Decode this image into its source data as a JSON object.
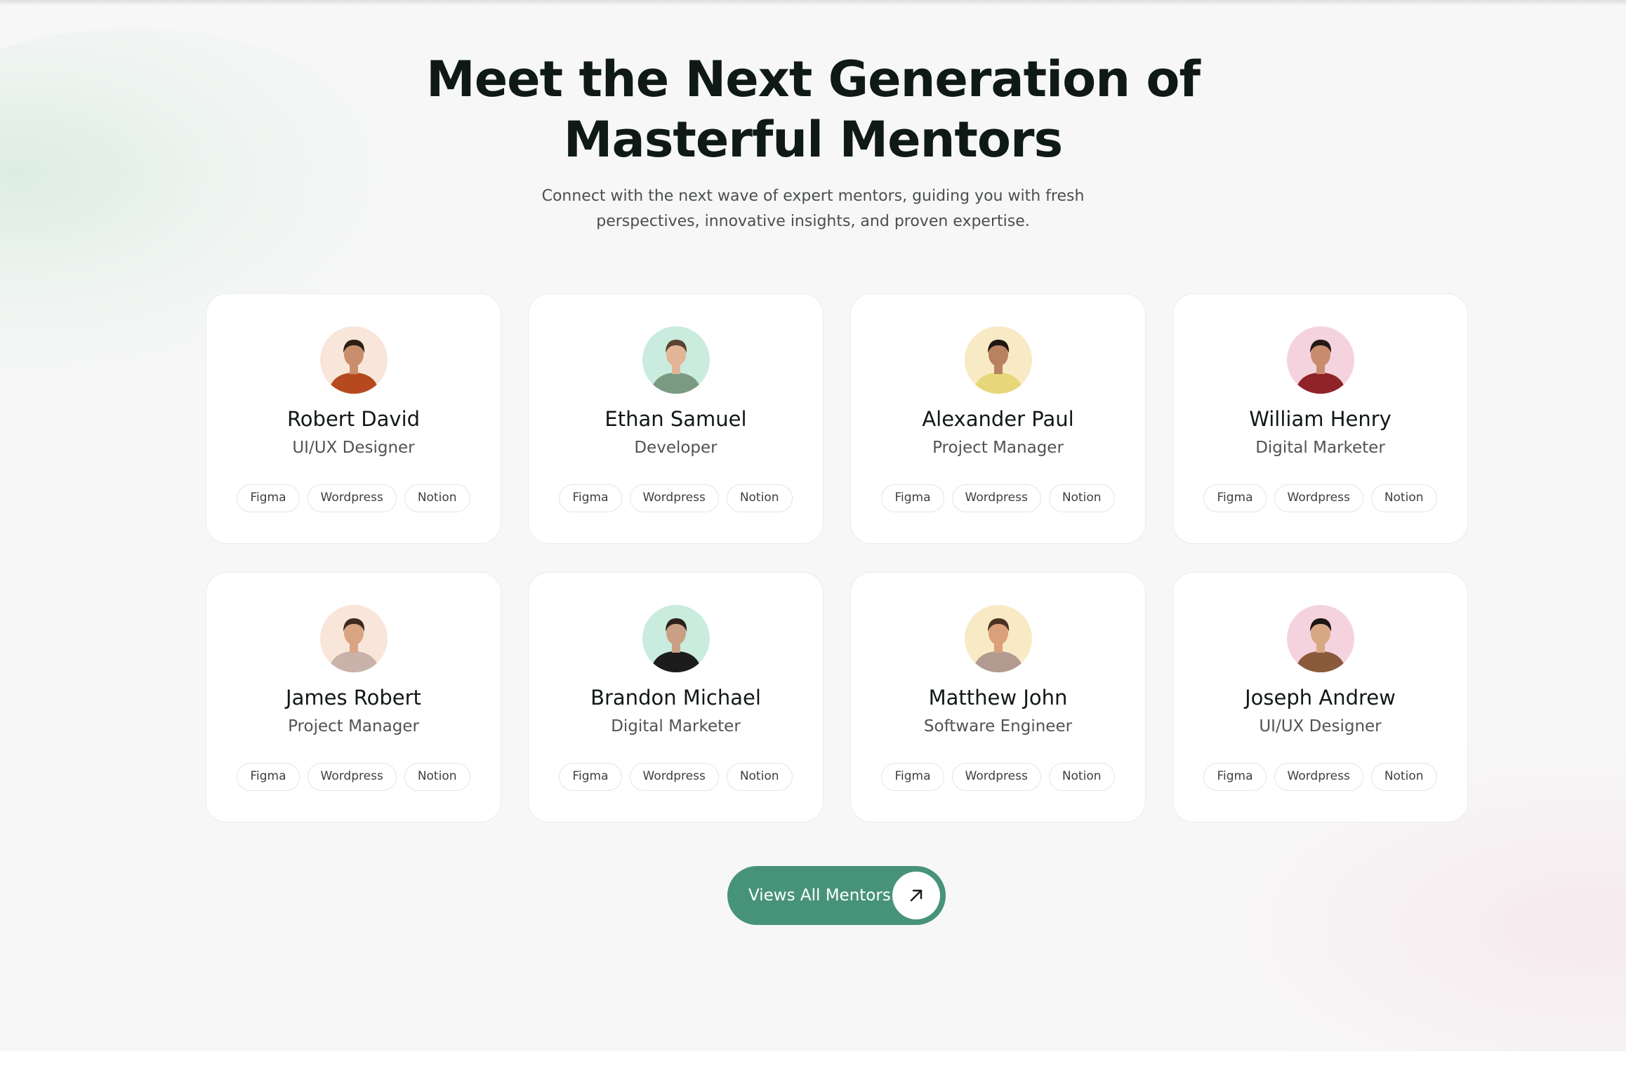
{
  "section": {
    "heading_line1": "Meet the Next Generation of",
    "heading_line2": "Masterful Mentors",
    "subtitle_line1": "Connect with the next wave of expert mentors, guiding you with fresh",
    "subtitle_line2": "perspectives, innovative insights, and proven expertise."
  },
  "mentors": [
    {
      "name": "Robert David",
      "role": "UI/UX Designer",
      "tags": [
        "Figma",
        "Wordpress",
        "Notion"
      ],
      "avatar_bg": "#f8e6da",
      "shirt": "#b64a1e",
      "skin": "#c98f6c",
      "hair": "#2b1f18"
    },
    {
      "name": "Ethan Samuel",
      "role": "Developer",
      "tags": [
        "Figma",
        "Wordpress",
        "Notion"
      ],
      "avatar_bg": "#c9ecdf",
      "shirt": "#7a9a82",
      "skin": "#e2b596",
      "hair": "#5a4332"
    },
    {
      "name": "Alexander Paul",
      "role": "Project Manager",
      "tags": [
        "Figma",
        "Wordpress",
        "Notion"
      ],
      "avatar_bg": "#f7eac5",
      "shirt": "#e8d77a",
      "skin": "#b88160",
      "hair": "#1f1712"
    },
    {
      "name": "William Henry",
      "role": "Digital Marketer",
      "tags": [
        "Figma",
        "Wordpress",
        "Notion"
      ],
      "avatar_bg": "#f5d3de",
      "shirt": "#8f2328",
      "skin": "#c98b6d",
      "hair": "#231a16"
    },
    {
      "name": "James Robert",
      "role": "Project Manager",
      "tags": [
        "Figma",
        "Wordpress",
        "Notion"
      ],
      "avatar_bg": "#f8e6da",
      "shirt": "#c9b2a9",
      "skin": "#d9a482",
      "hair": "#3a2a20"
    },
    {
      "name": "Brandon Michael",
      "role": "Digital Marketer",
      "tags": [
        "Figma",
        "Wordpress",
        "Notion"
      ],
      "avatar_bg": "#c9ecdf",
      "shirt": "#1c1c1c",
      "skin": "#caa084",
      "hair": "#2a211b"
    },
    {
      "name": "Matthew John",
      "role": "Software Engineer",
      "tags": [
        "Figma",
        "Wordpress",
        "Notion"
      ],
      "avatar_bg": "#f7eac5",
      "shirt": "#b39a8e",
      "skin": "#d9a07a",
      "hair": "#4a3222"
    },
    {
      "name": "Joseph Andrew",
      "role": "UI/UX Designer",
      "tags": [
        "Figma",
        "Wordpress",
        "Notion"
      ],
      "avatar_bg": "#f5d3de",
      "shirt": "#8a5a3a",
      "skin": "#d8a784",
      "hair": "#1c1614"
    }
  ],
  "cta": {
    "label": "Views All Mentors",
    "icon": "arrow-up-right-icon"
  },
  "colors": {
    "accent": "#47937a",
    "heading": "#0f1a17",
    "page_bg": "#f7f7f7"
  }
}
